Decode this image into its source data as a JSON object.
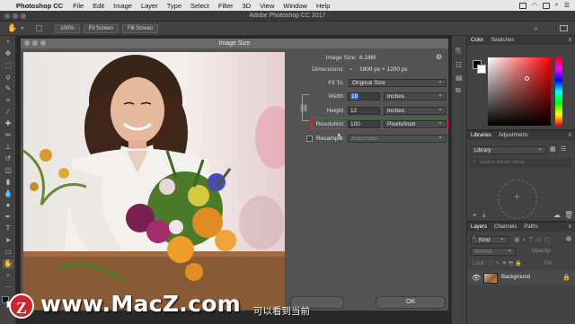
{
  "menubar": {
    "app": "Photoshop CC",
    "items": [
      "File",
      "Edit",
      "Image",
      "Layer",
      "Type",
      "Select",
      "Filter",
      "3D",
      "View",
      "Window",
      "Help"
    ]
  },
  "window_title": "Adobe Photoshop CC 2017",
  "optbar": {
    "zoom": "100%",
    "fit_screen": "Fit Screen",
    "fill_screen": "Fill Screen"
  },
  "dialog": {
    "title": "Image Size",
    "image_size_label": "Image Size:",
    "image_size_value": "6.18M",
    "dimensions_label": "Dimensions:",
    "dimensions_value": "1800 px × 1200 px",
    "fit_to_label": "Fit To:",
    "fit_to_value": "Original Size",
    "width_label": "Width:",
    "width_value": "18",
    "width_unit": "Inches",
    "height_label": "Height:",
    "height_value": "12",
    "height_unit": "Inches",
    "resolution_label": "Resolution:",
    "resolution_value": "100",
    "resolution_unit": "Pixels/Inch",
    "resample_label": "Resample:",
    "resample_value": "Automatic",
    "ok_label": "OK",
    "cancel_label": ""
  },
  "panels": {
    "color_tabs": [
      "Color",
      "Swatches"
    ],
    "libraries_tabs": [
      "Libraries",
      "Adjustments"
    ],
    "library_select": "Library",
    "library_search": "Search Adobe Stock",
    "layers_tabs": [
      "Layers",
      "Channels",
      "Paths"
    ],
    "kind_label": "Kind",
    "blend_mode": "Normal",
    "opacity_label": "Opacity:",
    "lock_label": "Lock:",
    "fill_label": "Fill:",
    "layer_name": "Background"
  },
  "overlay": {
    "logo_letter": "Z",
    "watermark": "www.MacZ.com",
    "subtitle": "可以看到当前"
  }
}
